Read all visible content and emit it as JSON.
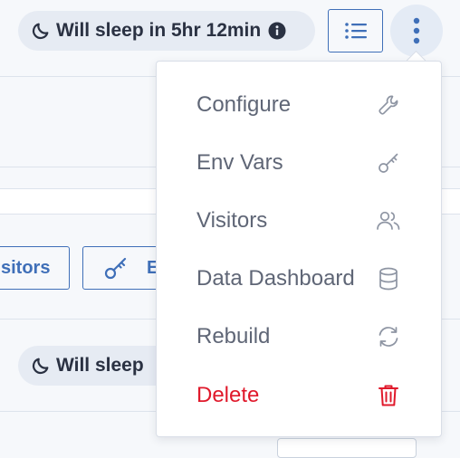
{
  "header": {
    "sleep_badge": "Will sleep in 5hr 12min",
    "info_icon": "info-icon",
    "list_icon": "list-icon",
    "menu_icon": "kebab-vertical-icon"
  },
  "background": {
    "visitors_button_partial": "sitors",
    "env_button_partial": "E",
    "sleep_badge_partial": "Will sleep"
  },
  "menu": {
    "items": [
      {
        "label": "Configure",
        "icon": "wrench-icon"
      },
      {
        "label": "Env Vars",
        "icon": "key-icon"
      },
      {
        "label": "Visitors",
        "icon": "users-icon"
      },
      {
        "label": "Data Dashboard",
        "icon": "database-icon"
      },
      {
        "label": "Rebuild",
        "icon": "refresh-icon"
      },
      {
        "label": "Delete",
        "icon": "trash-icon"
      }
    ]
  },
  "colors": {
    "accent": "#3f6fb8",
    "danger": "#e0192b",
    "menu_text": "#5f6676",
    "badge_bg": "#e6ebf3"
  }
}
